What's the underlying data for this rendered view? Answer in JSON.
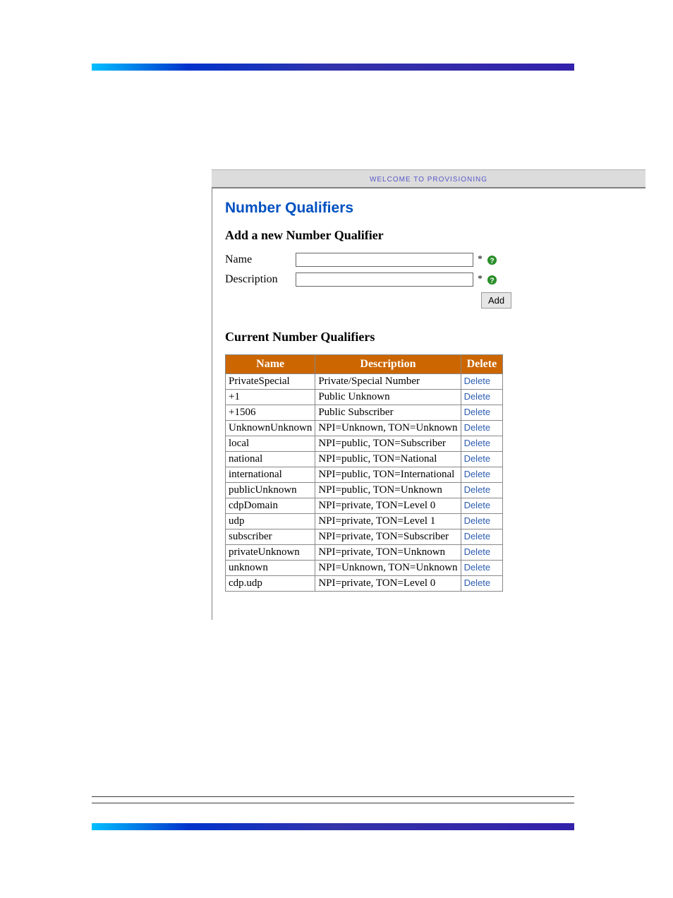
{
  "banner": {
    "text": "WELCOME TO PROVISIONING"
  },
  "page": {
    "title": "Number Qualifiers"
  },
  "addSection": {
    "title": "Add a new Number Qualifier",
    "nameLabel": "Name",
    "descriptionLabel": "Description",
    "nameValue": "",
    "descriptionValue": "",
    "requiredMark": "*",
    "addButton": "Add"
  },
  "currentSection": {
    "title": "Current Number Qualifiers",
    "headers": {
      "name": "Name",
      "description": "Description",
      "delete": "Delete"
    },
    "deleteLabel": "Delete",
    "rows": [
      {
        "name": "PrivateSpecial",
        "description": "Private/Special Number"
      },
      {
        "name": "+1",
        "description": "Public Unknown"
      },
      {
        "name": "+1506",
        "description": "Public Subscriber"
      },
      {
        "name": "UnknownUnknown",
        "description": "NPI=Unknown, TON=Unknown"
      },
      {
        "name": "local",
        "description": "NPI=public, TON=Subscriber"
      },
      {
        "name": "national",
        "description": "NPI=public, TON=National"
      },
      {
        "name": "international",
        "description": "NPI=public, TON=International"
      },
      {
        "name": "publicUnknown",
        "description": "NPI=public, TON=Unknown"
      },
      {
        "name": "cdpDomain",
        "description": "NPI=private, TON=Level 0"
      },
      {
        "name": "udp",
        "description": "NPI=private, TON=Level 1"
      },
      {
        "name": "subscriber",
        "description": "NPI=private, TON=Subscriber"
      },
      {
        "name": "privateUnknown",
        "description": "NPI=private, TON=Unknown"
      },
      {
        "name": "unknown",
        "description": "NPI=Unknown, TON=Unknown"
      },
      {
        "name": "cdp.udp",
        "description": "NPI=private, TON=Level 0"
      }
    ]
  },
  "icons": {
    "help": "help-circle-icon"
  }
}
